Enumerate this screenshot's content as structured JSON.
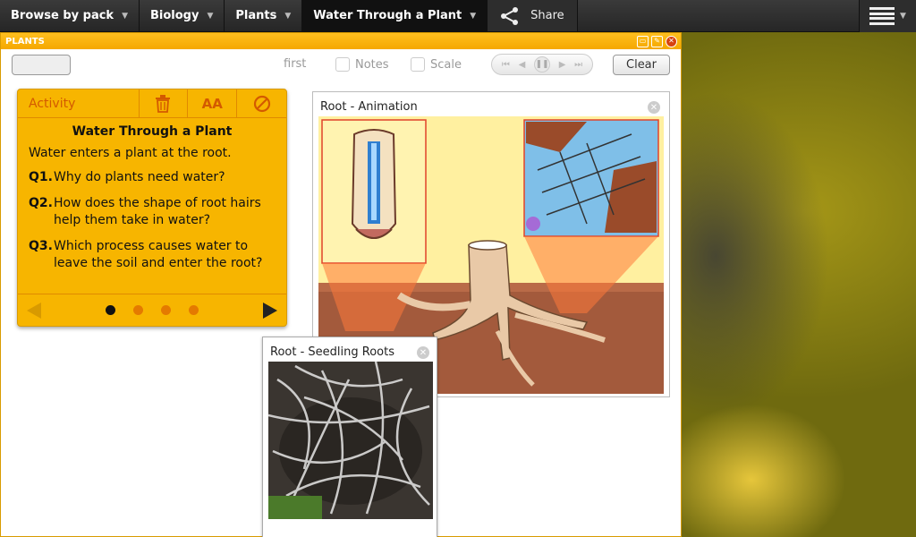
{
  "nav": {
    "items": [
      {
        "label": "Browse by pack"
      },
      {
        "label": "Biology"
      },
      {
        "label": "Plants"
      },
      {
        "label": "Water Through a Plant"
      }
    ],
    "share_label": "Share"
  },
  "plants_window": {
    "title": "PLANTS"
  },
  "toolbar": {
    "first_label": "first",
    "notes_label": "Notes",
    "scale_label": "Scale",
    "clear_label": "Clear"
  },
  "activity": {
    "tab_label": "Activity",
    "font_size_icon_text": "AA",
    "title": "Water Through a Plant",
    "intro": "Water enters a plant at the root.",
    "questions": [
      {
        "num": "Q1.",
        "text": "Why do plants need water?"
      },
      {
        "num": "Q2.",
        "text": "How does the shape of root hairs help them take in water?"
      },
      {
        "num": "Q3.",
        "text": "Which process causes water to leave the soil and enter the root?"
      }
    ],
    "page_count": 4,
    "current_page": 1
  },
  "animation_window": {
    "title": "Root - Animation"
  },
  "seedling_window": {
    "title": "Root - Seedling Roots"
  },
  "colors": {
    "accent": "#f7b500",
    "accent_dark": "#d35a00",
    "soil": "#a35a3c",
    "sky": "#fff0a0"
  },
  "icons": [
    "share-icon",
    "menu-icon",
    "trash-icon",
    "font-size-icon",
    "refresh-icon",
    "close-icon",
    "prev-icon",
    "next-icon",
    "pause-icon"
  ]
}
